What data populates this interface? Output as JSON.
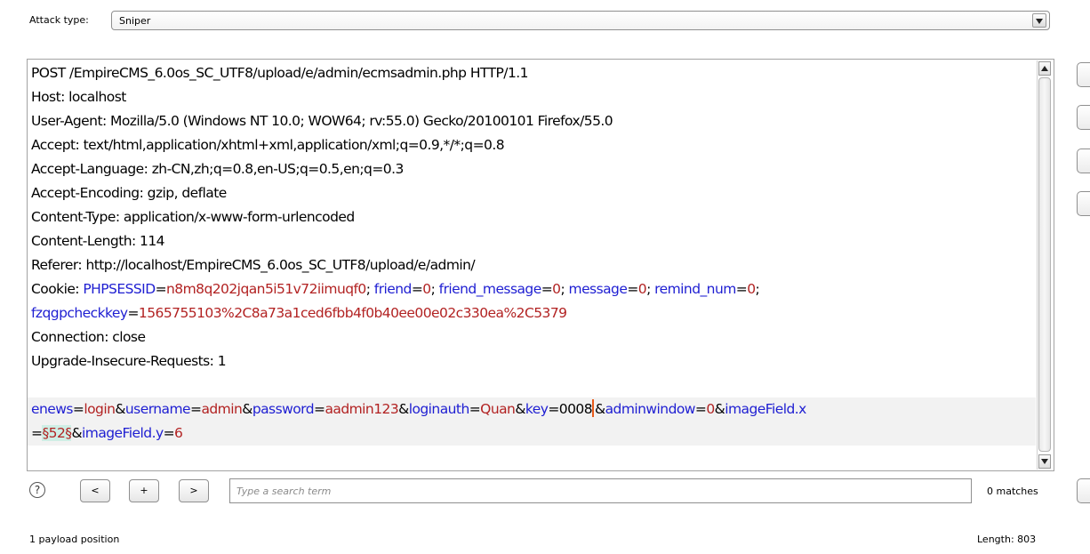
{
  "attack": {
    "label": "Attack type:",
    "selected": "Sniper"
  },
  "request": {
    "lines": [
      [
        {
          "t": "t",
          "s": "POST /EmpireCMS_6.0os_SC_UTF8/upload/e/admin/ecmsadmin.php HTTP/1.1"
        }
      ],
      [
        {
          "t": "t",
          "s": "Host: localhost"
        }
      ],
      [
        {
          "t": "t",
          "s": "User-Agent: Mozilla/5.0 (Windows NT 10.0; WOW64; rv:55.0) Gecko/20100101 Firefox/55.0"
        }
      ],
      [
        {
          "t": "t",
          "s": "Accept: text/html,application/xhtml+xml,application/xml;q=0.9,*/*;q=0.8"
        }
      ],
      [
        {
          "t": "t",
          "s": "Accept-Language: zh-CN,zh;q=0.8,en-US;q=0.5,en;q=0.3"
        }
      ],
      [
        {
          "t": "t",
          "s": "Accept-Encoding: gzip, deflate"
        }
      ],
      [
        {
          "t": "t",
          "s": "Content-Type: application/x-www-form-urlencoded"
        }
      ],
      [
        {
          "t": "t",
          "s": "Content-Length: 114"
        }
      ],
      [
        {
          "t": "t",
          "s": "Referer: http://localhost/EmpireCMS_6.0os_SC_UTF8/upload/e/admin/"
        }
      ],
      [
        {
          "t": "t",
          "s": "Cookie: "
        },
        {
          "t": "k",
          "s": "PHPSESSID"
        },
        {
          "t": "t",
          "s": "="
        },
        {
          "t": "v",
          "s": "n8m8q202jqan5i51v72iimuqf0"
        },
        {
          "t": "t",
          "s": "; "
        },
        {
          "t": "k",
          "s": "friend"
        },
        {
          "t": "t",
          "s": "="
        },
        {
          "t": "v",
          "s": "0"
        },
        {
          "t": "t",
          "s": "; "
        },
        {
          "t": "k",
          "s": "friend_message"
        },
        {
          "t": "t",
          "s": "="
        },
        {
          "t": "v",
          "s": "0"
        },
        {
          "t": "t",
          "s": "; "
        },
        {
          "t": "k",
          "s": "message"
        },
        {
          "t": "t",
          "s": "="
        },
        {
          "t": "v",
          "s": "0"
        },
        {
          "t": "t",
          "s": "; "
        },
        {
          "t": "k",
          "s": "remind_num"
        },
        {
          "t": "t",
          "s": "="
        },
        {
          "t": "v",
          "s": "0"
        },
        {
          "t": "t",
          "s": ";"
        }
      ],
      [
        {
          "t": "k",
          "s": "fzqgpcheckkey"
        },
        {
          "t": "t",
          "s": "="
        },
        {
          "t": "v",
          "s": "1565755103%2C8a73a1ced6fbb4f0b40ee00e02c330ea%2C5379"
        }
      ],
      [
        {
          "t": "t",
          "s": "Connection: close"
        }
      ],
      [
        {
          "t": "t",
          "s": "Upgrade-Insecure-Requests: 1"
        }
      ],
      [
        {
          "t": "t",
          "s": ""
        }
      ],
      [
        {
          "t": "k",
          "s": "enews"
        },
        {
          "t": "t",
          "s": "="
        },
        {
          "t": "v",
          "s": "login"
        },
        {
          "t": "t",
          "s": "&"
        },
        {
          "t": "k",
          "s": "username"
        },
        {
          "t": "t",
          "s": "="
        },
        {
          "t": "v",
          "s": "admin"
        },
        {
          "t": "t",
          "s": "&"
        },
        {
          "t": "k",
          "s": "password"
        },
        {
          "t": "t",
          "s": "="
        },
        {
          "t": "v",
          "s": "aadmin123"
        },
        {
          "t": "t",
          "s": "&"
        },
        {
          "t": "k",
          "s": "loginauth"
        },
        {
          "t": "t",
          "s": "="
        },
        {
          "t": "v",
          "s": "Quan"
        },
        {
          "t": "t",
          "s": "&"
        },
        {
          "t": "k",
          "s": "key"
        },
        {
          "t": "t",
          "s": "="
        },
        {
          "t": "t",
          "s": "0008"
        },
        {
          "t": "caret",
          "s": ""
        },
        {
          "t": "t",
          "s": "&"
        },
        {
          "t": "k",
          "s": "adminwindow"
        },
        {
          "t": "t",
          "s": "="
        },
        {
          "t": "v",
          "s": "0"
        },
        {
          "t": "t",
          "s": "&"
        },
        {
          "t": "k",
          "s": "imageField.x"
        }
      ],
      [
        {
          "t": "t",
          "s": "="
        },
        {
          "t": "marker",
          "s": "§52§"
        },
        {
          "t": "t",
          "s": "&"
        },
        {
          "t": "k",
          "s": "imageField.y"
        },
        {
          "t": "t",
          "s": "="
        },
        {
          "t": "v",
          "s": "6"
        }
      ]
    ],
    "highlighted_lines": [
      14,
      15
    ]
  },
  "search": {
    "help": "?",
    "prev": "<",
    "add": "+",
    "next": ">",
    "placeholder": "Type a search term",
    "matches": "0 matches"
  },
  "status": {
    "payload_positions": "1 payload position",
    "length": "Length: 803"
  }
}
